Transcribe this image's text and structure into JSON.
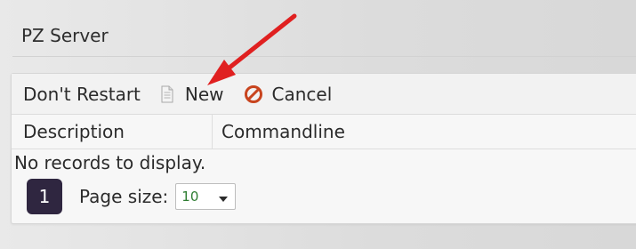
{
  "header": {
    "title": "PZ Server"
  },
  "toolbar": {
    "restart_label": "Don't Restart",
    "new_label": "New",
    "cancel_label": "Cancel",
    "new_icon": "document-icon",
    "cancel_icon": "no-entry-icon"
  },
  "grid": {
    "columns": [
      "Description",
      "Commandline"
    ],
    "empty_message": "No records to display."
  },
  "pager": {
    "current_page": "1",
    "page_size_label": "Page size:",
    "page_size_value": "10"
  },
  "colors": {
    "cancel_icon": "#c8441e",
    "page_button": "#2f2640",
    "annotation_arrow": "#e02020",
    "page_size_value": "#2e7d32"
  }
}
